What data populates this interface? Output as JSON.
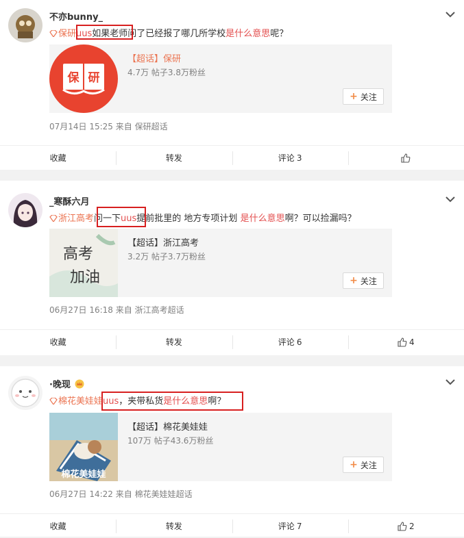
{
  "actions": {
    "collect": "收藏",
    "forward": "转发",
    "comment": "评论",
    "follow": "关注"
  },
  "posts": [
    {
      "username": "不亦bunny_",
      "topic_tag": "保研",
      "text_a": "uus",
      "text_b": "如果老师问了已经报了哪几所学校",
      "text_hl": "是什么意思",
      "text_c": "呢？",
      "topic": {
        "title": "【超话】保研",
        "stats": "4.7万 帖子3.8万粉丝",
        "thumb_text": "保研"
      },
      "meta": "07月14日 15:25  来自 保研超话",
      "comment_count": "3",
      "like_count": ""
    },
    {
      "username": "_寒酥六月",
      "topic_tag": "浙江高考",
      "text_a": "问一下",
      "text_b": "uus",
      "text_c": "提前批里的 地方专项计划 ",
      "text_hl": "是什么意思",
      "text_d": "啊？可以捡漏吗？",
      "topic": {
        "title": "【超话】浙江高考",
        "stats": "3.2万 帖子3.7万粉丝",
        "thumb_text": "高考加油"
      },
      "meta": "06月27日 16:18  来自 浙江高考超话",
      "comment_count": "6",
      "like_count": "4"
    },
    {
      "username": "·晚现",
      "topic_tag": "棉花美娃娃",
      "text_a": "uus",
      "text_b": "，夹带私货",
      "text_hl": "是什么意思",
      "text_c": "啊？",
      "topic": {
        "title": "【超话】棉花美娃娃",
        "stats": "107万 帖子43.6万粉丝",
        "thumb_text": "棉花美娃娃"
      },
      "meta": "06月27日 14:22  来自 棉花美娃娃超话",
      "comment_count": "7",
      "like_count": "2"
    }
  ]
}
